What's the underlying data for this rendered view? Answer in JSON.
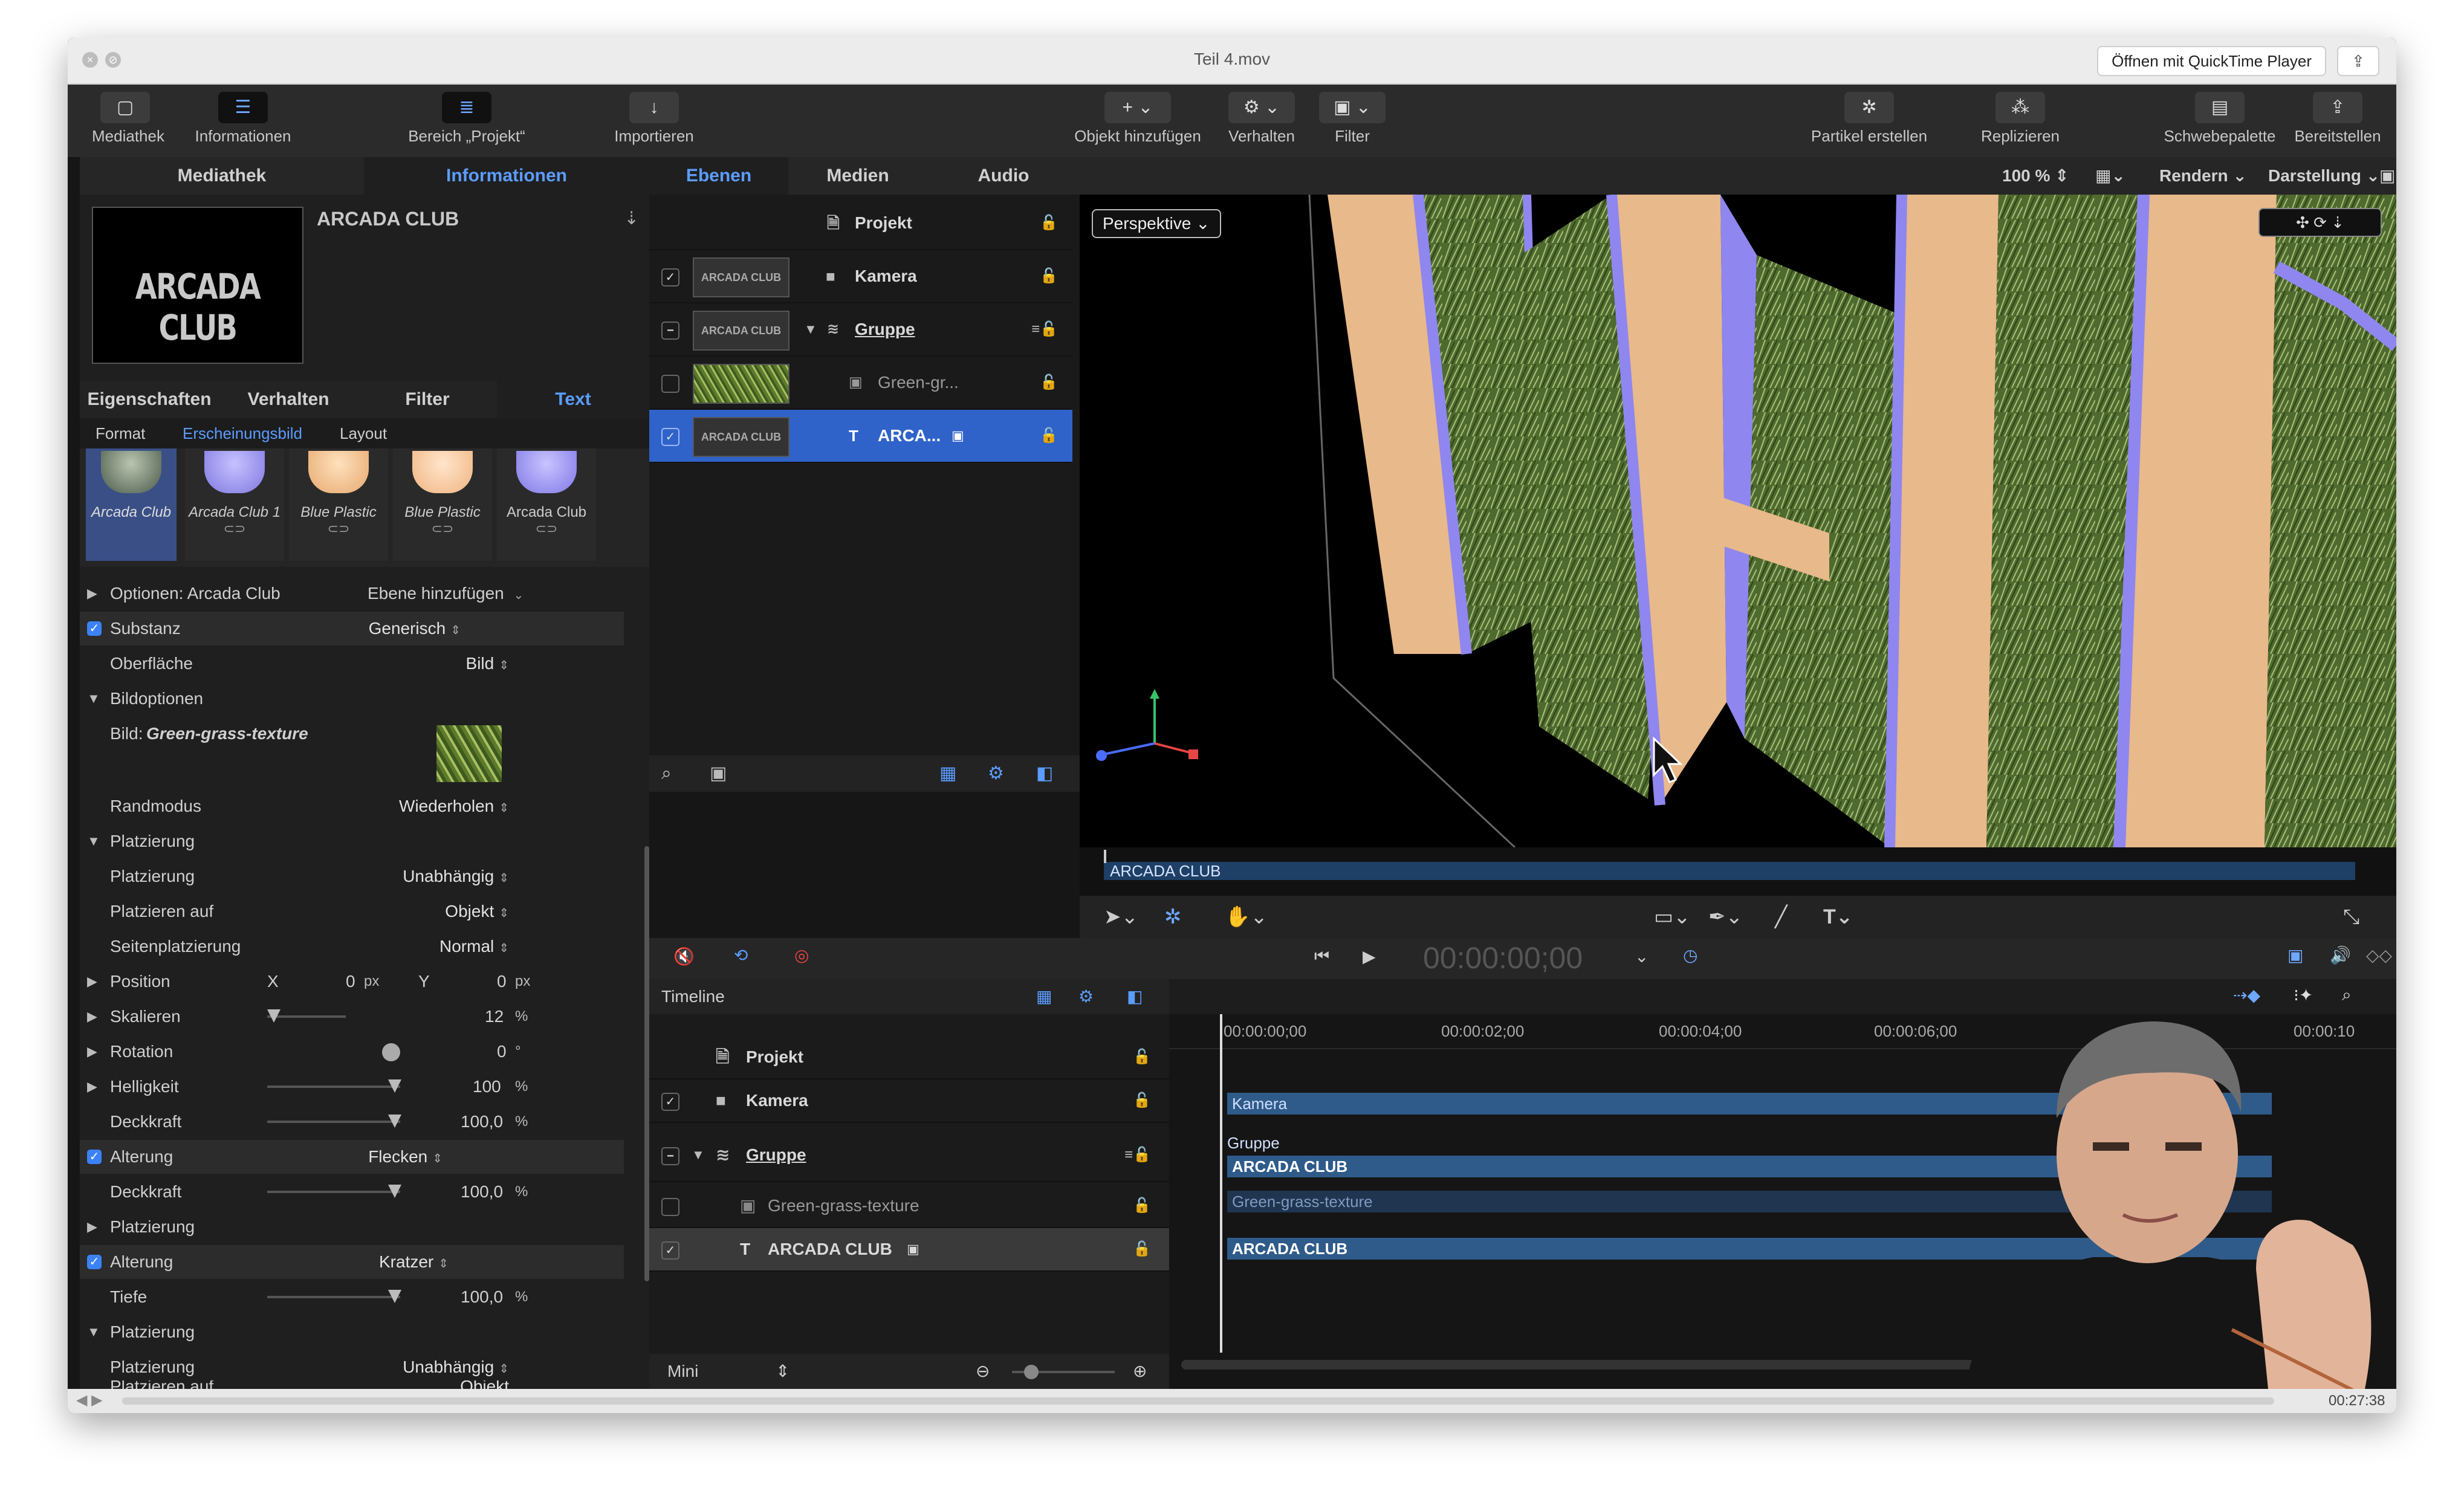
{
  "window": {
    "title": "Teil 4.mov",
    "open_with": "Öffnen mit QuickTime Player"
  },
  "toolbar": {
    "items": [
      {
        "label": "Mediathek",
        "icon": "library-icon"
      },
      {
        "label": "Informationen",
        "icon": "inspector-icon"
      },
      {
        "label": "Bereich „Projekt“",
        "icon": "project-pane-icon"
      },
      {
        "label": "Importieren",
        "icon": "import-icon"
      },
      {
        "label": "Objekt hinzufügen",
        "icon": "plus-icon"
      },
      {
        "label": "Verhalten",
        "icon": "gear-icon"
      },
      {
        "label": "Filter",
        "icon": "filter-icon"
      },
      {
        "label": "Partikel erstellen",
        "icon": "particles-icon"
      },
      {
        "label": "Replizieren",
        "icon": "replicate-icon"
      },
      {
        "label": "Schwebepalette",
        "icon": "hud-icon"
      },
      {
        "label": "Bereitstellen",
        "icon": "share-icon"
      }
    ]
  },
  "left_tabs": [
    "Mediathek",
    "Informationen"
  ],
  "preview": {
    "title": "ARCADA CLUB",
    "thumb_text": "ARCADA CLUB"
  },
  "inspector_tabs": [
    "Eigenschaften",
    "Verhalten",
    "Filter",
    "Text"
  ],
  "sub_tabs": [
    "Format",
    "Erscheinungsbild",
    "Layout"
  ],
  "presets": [
    "Arcada Club",
    "Arcada Club 1",
    "Blue Plastic",
    "Blue Plastic",
    "Arcada Club"
  ],
  "params": {
    "options": "Optionen: Arcada Club",
    "add_layer": "Ebene hinzufügen",
    "substanz": "Substanz",
    "substanz_val": "Generisch",
    "oberflaeche": "Oberfläche",
    "oberflaeche_val": "Bild",
    "bildoptionen": "Bildoptionen",
    "bild_label": "Bild:",
    "bild_name": "Green-grass-texture",
    "randmodus": "Randmodus",
    "randmodus_val": "Wiederholen",
    "platzierung_group": "Platzierung",
    "platzierung": "Platzierung",
    "platzierung_val": "Unabhängig",
    "platzieren_auf": "Platzieren auf",
    "platzieren_auf_val": "Objekt",
    "seitenplatzierung": "Seitenplatzierung",
    "seitenplatzierung_val": "Normal",
    "position": "Position",
    "pos_x_label": "X",
    "pos_x": "0",
    "pos_y_label": "Y",
    "pos_y": "0",
    "px": "px",
    "skalieren": "Skalieren",
    "skalieren_val": "12",
    "pct": "%",
    "rotation": "Rotation",
    "rotation_val": "0",
    "deg": "°",
    "helligkeit": "Helligkeit",
    "helligkeit_val": "100",
    "deckkraft": "Deckkraft",
    "deckkraft_val": "100,0",
    "alterung1": "Alterung",
    "alterung1_val": "Flecken",
    "deckkraft2": "Deckkraft",
    "deckkraft2_val": "100,0",
    "platzierung2": "Platzierung",
    "alterung2": "Alterung",
    "alterung2_val": "Kratzer",
    "tiefe": "Tiefe",
    "tiefe_val": "100,0",
    "platzierung3": "Platzierung",
    "platzierung4": "Platzierung",
    "platzierung4_val": "Unabhängig",
    "platzieren_auf2": "Platzieren auf",
    "platzieren_auf2_val": "Objekt"
  },
  "layer_tabs": [
    "Ebenen",
    "Medien",
    "Audio"
  ],
  "layers": [
    {
      "name": "Projekt"
    },
    {
      "name": "Kamera",
      "thumb": "ARCADA CLUB"
    },
    {
      "name": "Gruppe",
      "thumb": "ARCADA CLUB"
    },
    {
      "name": "Green-gr..."
    },
    {
      "name": "ARCA...",
      "thumb": "ARCADA CLUB"
    }
  ],
  "canvas": {
    "zoom": "100 %",
    "render": "Rendern",
    "view": "Darstellung",
    "camera": "Perspektive",
    "mini_track": "ARCADA CLUB"
  },
  "transport": {
    "timecode": "00:00:00;00"
  },
  "timeline": {
    "label": "Timeline",
    "rows": [
      "Projekt",
      "Kamera",
      "Gruppe",
      "Green-grass-texture",
      "ARCADA CLUB"
    ],
    "ruler": [
      "00:00:00;00",
      "00:00:02;00",
      "00:00:04;00",
      "00:00:06;00",
      "00:00:10"
    ],
    "bars": {
      "kamera": "Kamera",
      "gruppe": "Gruppe",
      "gruppe_sub": "ARCADA CLUB",
      "grass": "Green-grass-texture",
      "arcada": "ARCADA CLUB"
    },
    "mini": "Mini"
  },
  "scrub": {
    "time": "00:27:38"
  },
  "colors": {
    "accent": "#5b9cff",
    "selection": "#2f63c9",
    "bar": "#2f5b8a"
  }
}
